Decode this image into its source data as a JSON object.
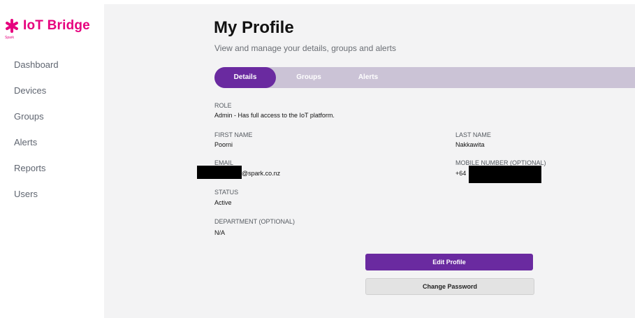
{
  "brand": {
    "name": "IoT Bridge",
    "sub": "Spark"
  },
  "nav": {
    "items": [
      {
        "label": "Dashboard"
      },
      {
        "label": "Devices"
      },
      {
        "label": "Groups"
      },
      {
        "label": "Alerts"
      },
      {
        "label": "Reports"
      },
      {
        "label": "Users"
      }
    ]
  },
  "page": {
    "title": "My Profile",
    "subtitle": "View and manage your details, groups and alerts"
  },
  "tabs": [
    {
      "label": "Details",
      "active": true
    },
    {
      "label": "Groups",
      "active": false
    },
    {
      "label": "Alerts",
      "active": false
    }
  ],
  "profile": {
    "role_label": "ROLE",
    "role_value": "Admin - Has full access to the IoT platform.",
    "first_name_label": "FIRST NAME",
    "first_name_value": "Poorni",
    "last_name_label": "LAST NAME",
    "last_name_value": "Nakkawita",
    "email_label": "EMAIL",
    "email_value": "@spark.co.nz",
    "mobile_label": "MOBILE NUMBER (OPTIONAL)",
    "mobile_value": "+64",
    "status_label": "STATUS",
    "status_value": "Active",
    "department_label": "DEPARTMENT (OPTIONAL)",
    "department_value": "N/A"
  },
  "actions": {
    "edit_label": "Edit Profile",
    "password_label": "Change Password"
  },
  "colors": {
    "brand_pink": "#e6007e",
    "accent_purple": "#6a2aa0",
    "tabbar_bg": "#cbc3d6"
  }
}
